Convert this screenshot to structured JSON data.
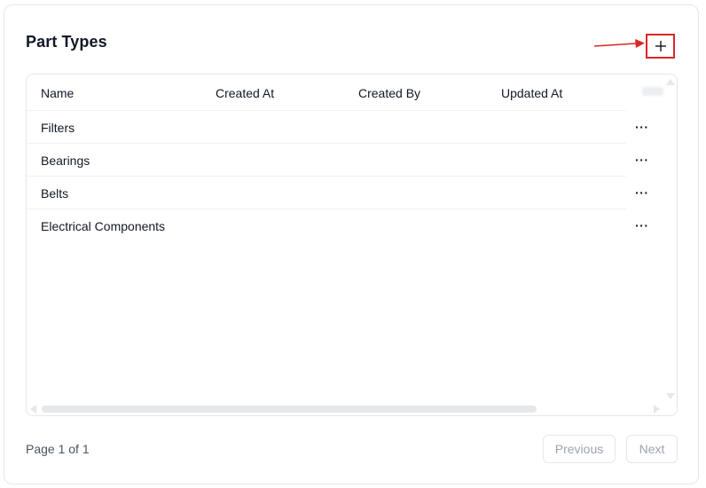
{
  "header": {
    "title": "Part Types",
    "add_icon": "plus-icon"
  },
  "table": {
    "columns": [
      "Name",
      "Created At",
      "Created By",
      "Updated At"
    ],
    "rows": [
      {
        "name": "Filters",
        "created_at": "",
        "created_by": "",
        "updated_at": ""
      },
      {
        "name": "Bearings",
        "created_at": "",
        "created_by": "",
        "updated_at": ""
      },
      {
        "name": "Belts",
        "created_at": "",
        "created_by": "",
        "updated_at": ""
      },
      {
        "name": "Electrical Components",
        "created_at": "",
        "created_by": "",
        "updated_at": ""
      }
    ],
    "row_menu_label": "···",
    "row_menu_icon": "more-horizontal-icon"
  },
  "pagination": {
    "page_info": "Page 1 of 1",
    "previous_label": "Previous",
    "next_label": "Next"
  },
  "colors": {
    "annotation": "#dc2626",
    "border": "#e5e7eb",
    "text": "#111827",
    "muted": "#9ca3af"
  }
}
